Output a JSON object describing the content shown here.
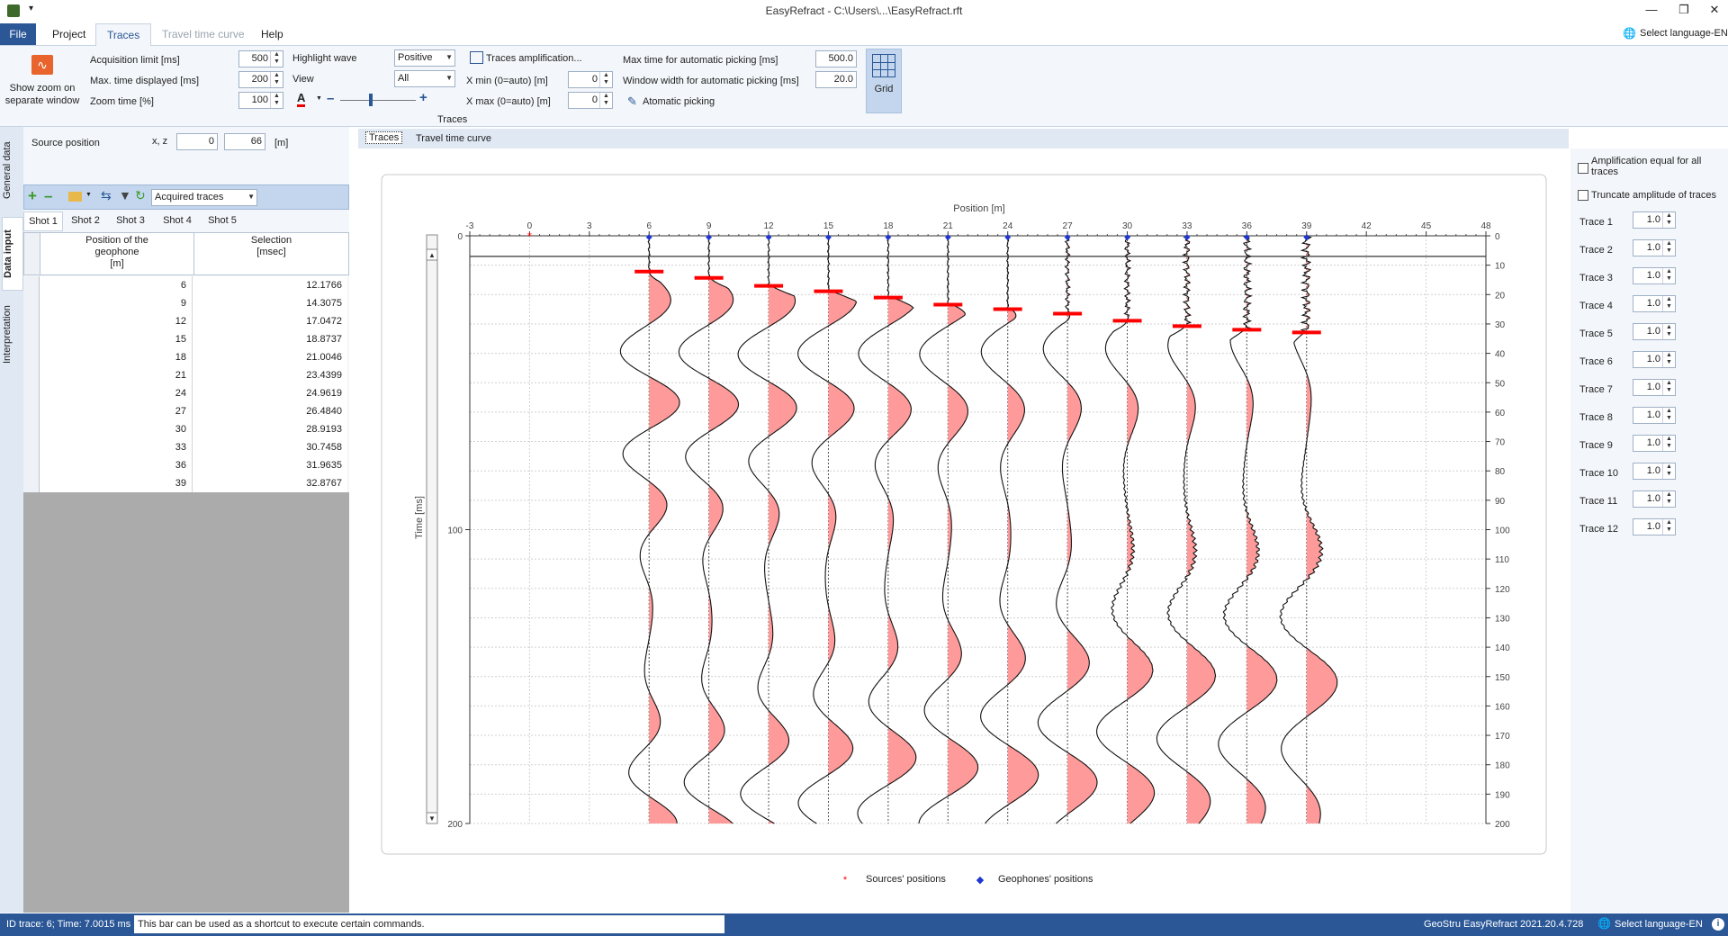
{
  "window": {
    "title": "EasyRefract - C:\\Users\\...\\EasyRefract.rft"
  },
  "menu": {
    "file": "File",
    "project": "Project",
    "traces": "Traces",
    "travel": "Travel time curve",
    "help": "Help",
    "language": "Select language-EN"
  },
  "ribbon": {
    "zoom_btn_1": "Show zoom on",
    "zoom_btn_2": "separate window",
    "acq_label": "Acquisition limit [ms]",
    "acq_value": "500",
    "maxtime_label": "Max. time displayed [ms]",
    "maxtime_value": "200",
    "zoomtime_label": "Zoom time [%]",
    "zoomtime_value": "100",
    "highlight_label": "Highlight wave",
    "highlight_value": "Positive",
    "view_label": "View",
    "view_value": "All",
    "amp_label": "Traces amplification...",
    "xmin_label": "X min (0=auto) [m]",
    "xmin_value": "0",
    "xmax_label": "X max (0=auto) [m]",
    "xmax_value": "0",
    "maxauto_label": "Max time for automatic picking [ms]",
    "maxauto_value": "500.0",
    "window_label": "Window width for automatic picking [ms]",
    "window_value": "20.0",
    "autopick_label": "Atomatic picking",
    "grid_label": "Grid",
    "group_label": "Traces"
  },
  "vtabs": {
    "general": "General data",
    "input": "Data input",
    "interp": "Interpretation"
  },
  "left": {
    "source_label": "Source position",
    "xz_label": "x, z",
    "src_x": "0",
    "src_z": "66",
    "unit": "[m]",
    "combo": "Acquired traces",
    "shots": [
      "Shot 1",
      "Shot 2",
      "Shot 3",
      "Shot 4",
      "Shot 5"
    ],
    "col1": "Position of the\ngeophone\n[m]",
    "col2": "Selection\n[msec]",
    "rows": [
      {
        "pos": "6",
        "sel": "12.1766"
      },
      {
        "pos": "9",
        "sel": "14.3075"
      },
      {
        "pos": "12",
        "sel": "17.0472"
      },
      {
        "pos": "15",
        "sel": "18.8737"
      },
      {
        "pos": "18",
        "sel": "21.0046"
      },
      {
        "pos": "21",
        "sel": "23.4399"
      },
      {
        "pos": "24",
        "sel": "24.9619"
      },
      {
        "pos": "27",
        "sel": "26.4840"
      },
      {
        "pos": "30",
        "sel": "28.9193"
      },
      {
        "pos": "33",
        "sel": "30.7458"
      },
      {
        "pos": "36",
        "sel": "31.9635"
      },
      {
        "pos": "39",
        "sel": "32.8767"
      }
    ]
  },
  "center": {
    "tab1": "Traces",
    "tab2": "Travel time curve",
    "legend_src": "Sources' positions",
    "legend_geo": "Geophones' positions"
  },
  "chart_data": {
    "type": "line",
    "xlabel": "Position [m]",
    "ylabel": "Time [ms]",
    "x_ticks": [
      -3,
      0,
      3,
      6,
      9,
      12,
      15,
      18,
      21,
      24,
      27,
      30,
      33,
      36,
      39,
      42,
      45,
      48
    ],
    "y_ticks_left": [
      0,
      100,
      200
    ],
    "y_ticks_right": [
      0,
      10,
      20,
      30,
      40,
      50,
      60,
      70,
      80,
      90,
      100,
      110,
      120,
      130,
      140,
      150,
      160,
      170,
      180,
      190,
      200
    ],
    "xlim": [
      -3,
      48
    ],
    "ylim": [
      0,
      200
    ],
    "source_x": 0,
    "geophones": [
      6,
      9,
      12,
      15,
      18,
      21,
      24,
      27,
      30,
      33,
      36,
      39
    ],
    "picks_ms": [
      12.1766,
      14.3075,
      17.0472,
      18.8737,
      21.0046,
      23.4399,
      24.9619,
      26.484,
      28.9193,
      30.7458,
      31.9635,
      32.8767
    ],
    "horizontal_line_ms": 7
  },
  "right": {
    "amp_equal": "Amplification equal for all traces",
    "truncate": "Truncate amplitude of traces",
    "traces": [
      {
        "label": "Trace  1",
        "value": "1.0"
      },
      {
        "label": "Trace  2",
        "value": "1.0"
      },
      {
        "label": "Trace  3",
        "value": "1.0"
      },
      {
        "label": "Trace  4",
        "value": "1.0"
      },
      {
        "label": "Trace  5",
        "value": "1.0"
      },
      {
        "label": "Trace  6",
        "value": "1.0"
      },
      {
        "label": "Trace  7",
        "value": "1.0"
      },
      {
        "label": "Trace  8",
        "value": "1.0"
      },
      {
        "label": "Trace  9",
        "value": "1.0"
      },
      {
        "label": "Trace  10",
        "value": "1.0"
      },
      {
        "label": "Trace  11",
        "value": "1.0"
      },
      {
        "label": "Trace  12",
        "value": "1.0"
      }
    ]
  },
  "status": {
    "left": "ID trace: 6; Time: 7.0015 ms",
    "hint": "This bar can be used as a shortcut to execute certain commands.",
    "version": "GeoStru EasyRefract 2021.20.4.728",
    "lang": "Select language-EN"
  },
  "colors": {
    "accent": "#2b5797",
    "pick": "#ff0000",
    "fill": "#ff9a9a",
    "geophone": "#1f35d6"
  }
}
